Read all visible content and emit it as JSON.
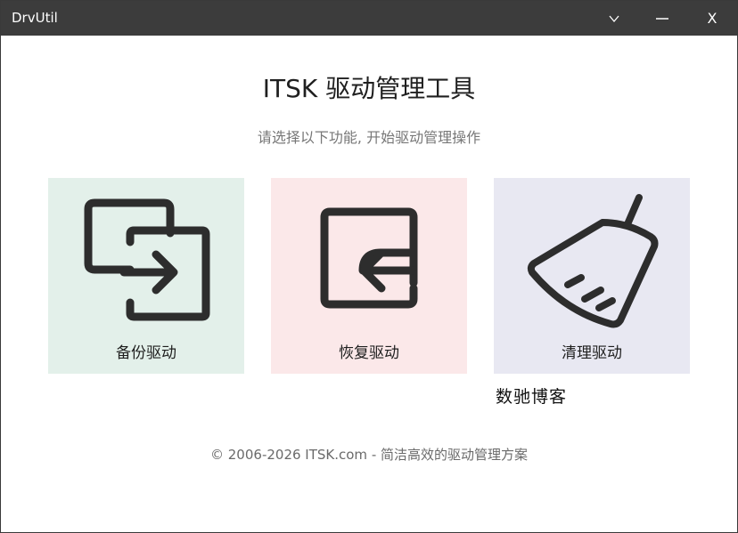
{
  "window": {
    "title": "DrvUtil",
    "controls": {
      "dropdown_icon": "chevron-down-icon",
      "minimize_icon": "minimize-icon",
      "close_label": "X"
    },
    "titlebar_color": "#3c3c3c"
  },
  "header": {
    "title": "ITSK 驱动管理工具",
    "subtitle": "请选择以下功能, 开始驱动管理操作"
  },
  "cards": [
    {
      "label": "备份驱动",
      "icon": "backup-export-icon",
      "background": "#e3f0ea"
    },
    {
      "label": "恢复驱动",
      "icon": "restore-import-icon",
      "background": "#fbe8e9"
    },
    {
      "label": "清理驱动",
      "icon": "broom-icon",
      "background": "#e8e8f2"
    }
  ],
  "watermark": "数驰博客",
  "footer": "© 2006-2026 ITSK.com - 简洁高效的驱动管理方案"
}
